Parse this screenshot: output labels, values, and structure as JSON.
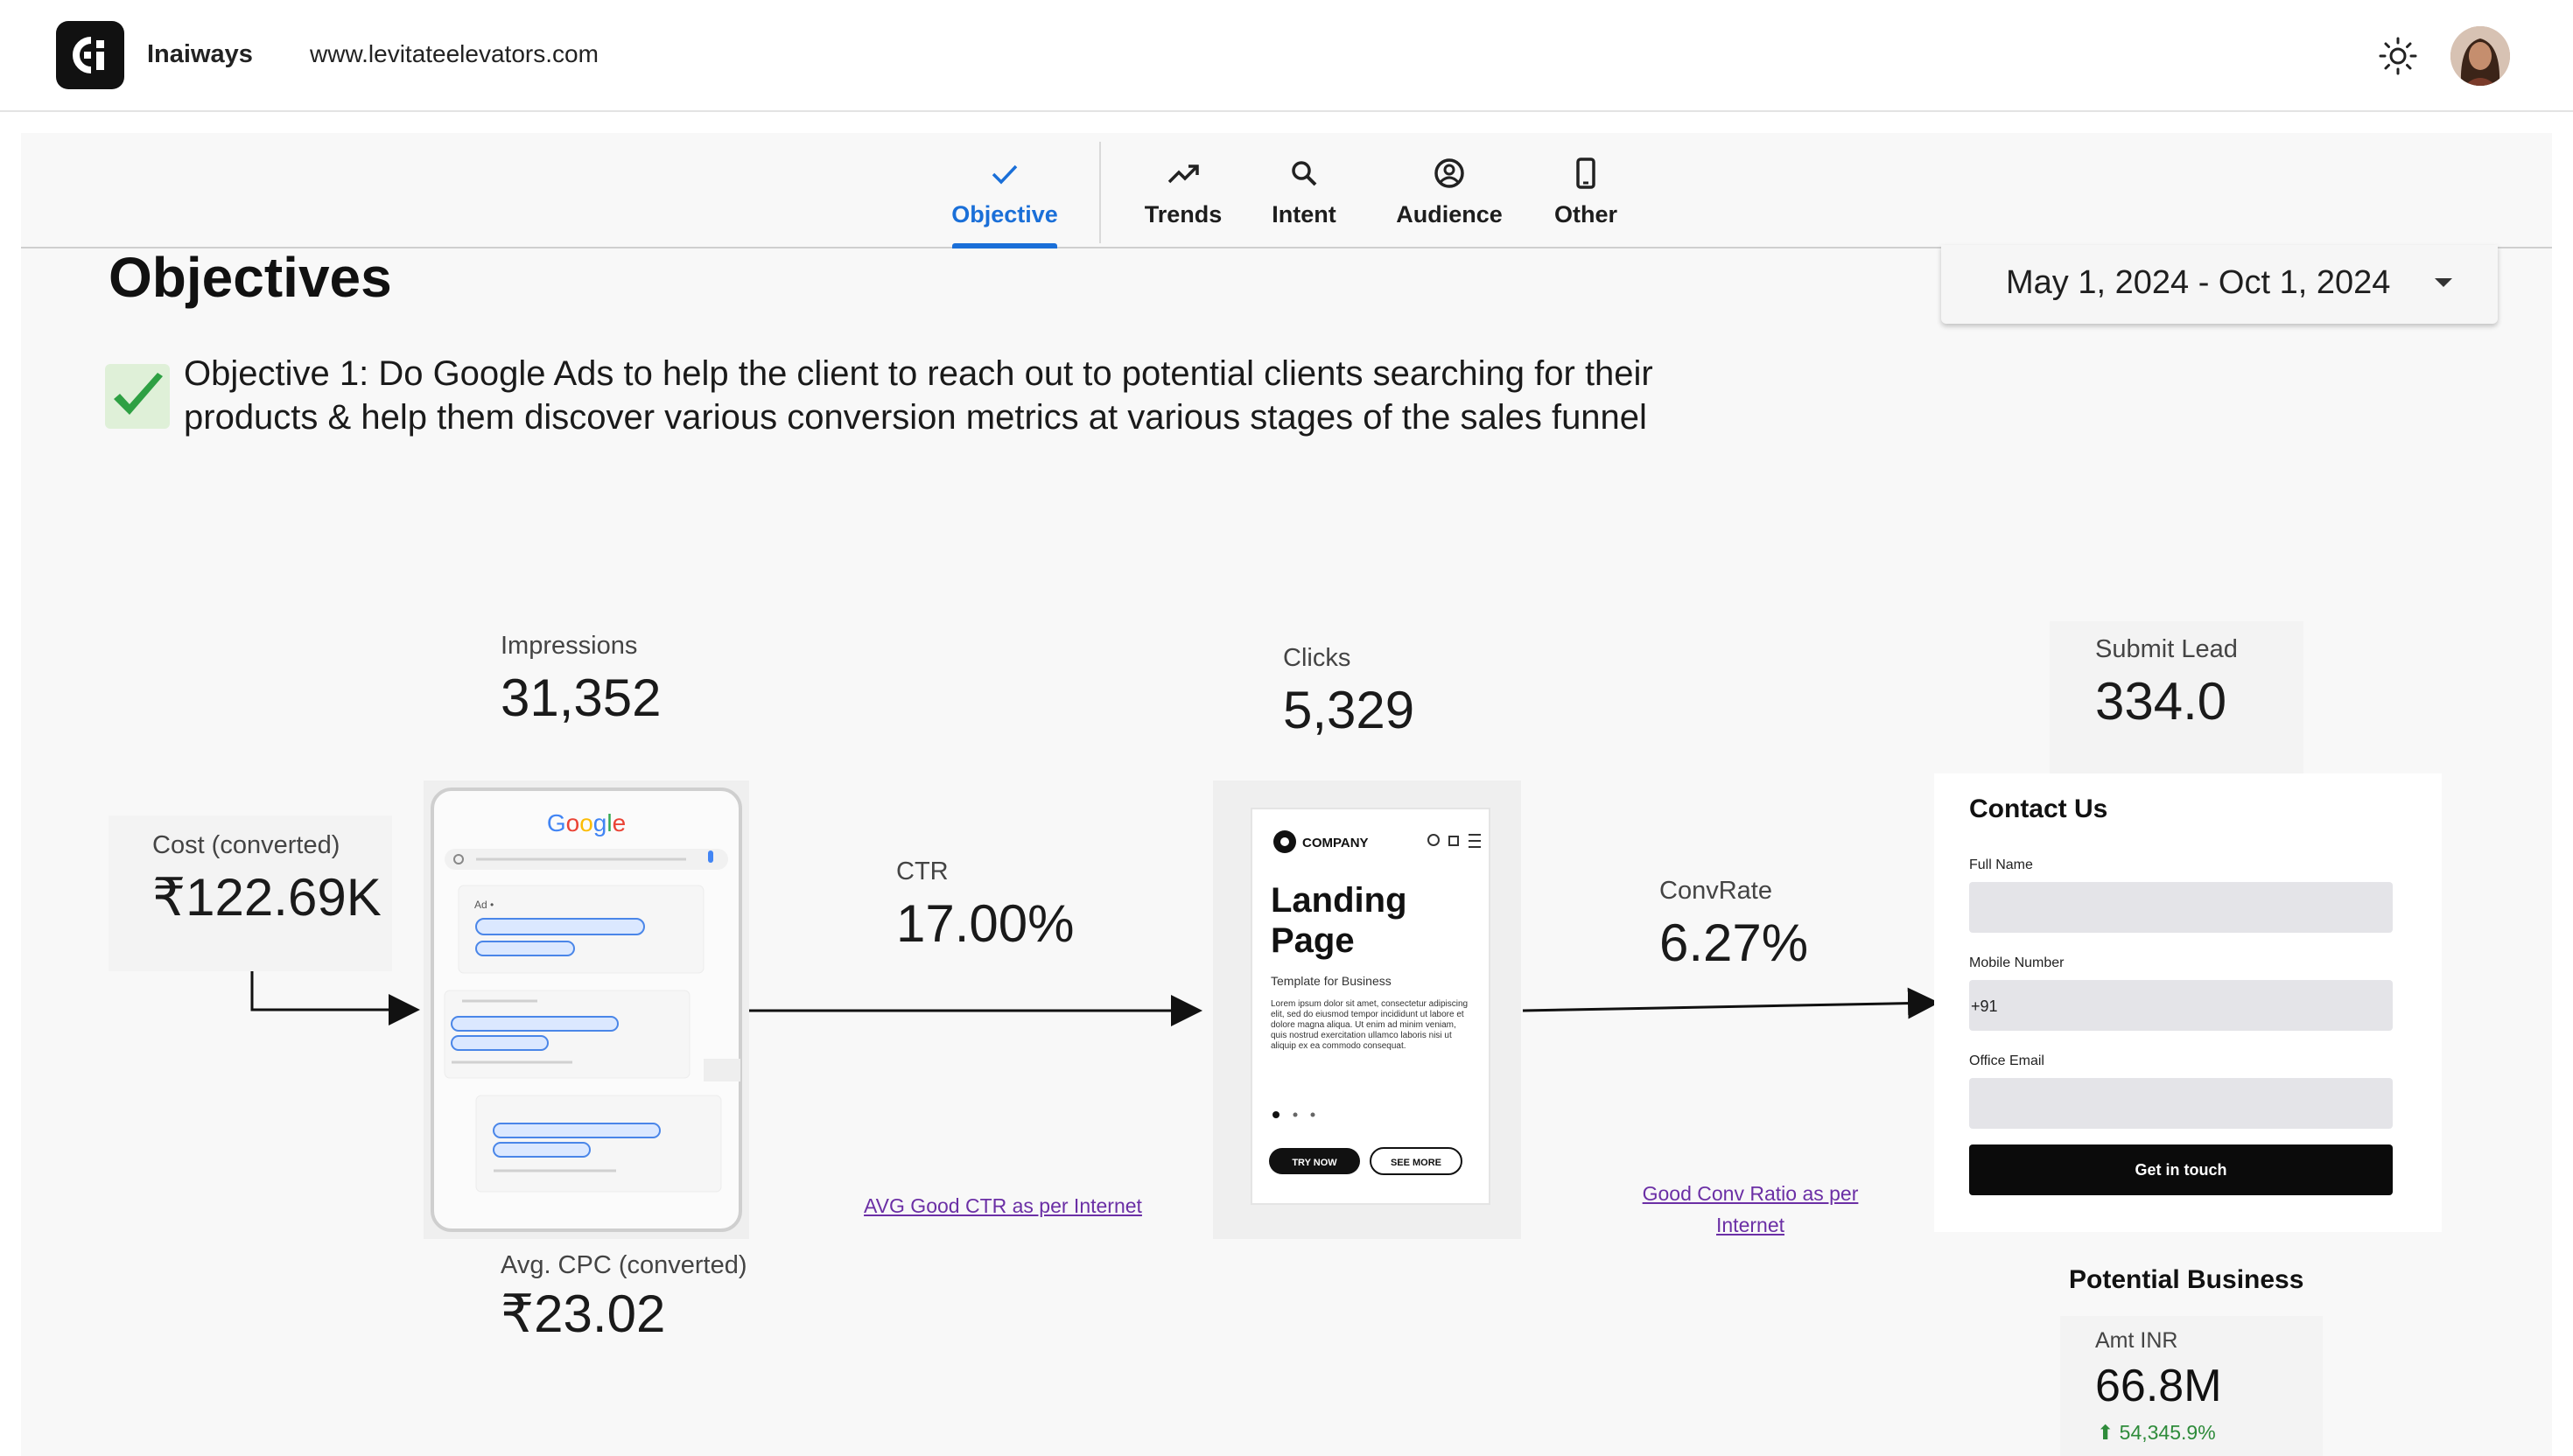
{
  "header": {
    "brand": "Inaiways",
    "site_url": "www.levitateelevators.com",
    "theme_icon": "sun-icon",
    "avatar_icon": "user-avatar"
  },
  "tabs": [
    {
      "label": "Objective",
      "icon": "check-icon",
      "active": true
    },
    {
      "label": "Trends",
      "icon": "trending-up-icon",
      "active": false
    },
    {
      "label": "Intent",
      "icon": "search-icon",
      "active": false
    },
    {
      "label": "Audience",
      "icon": "person-circle-icon",
      "active": false
    },
    {
      "label": "Other",
      "icon": "phone-icon",
      "active": false
    }
  ],
  "page": {
    "title": "Objectives",
    "date_range": "May 1, 2024 - Oct 1, 2024",
    "objective_text": "Objective 1: Do Google Ads to help the client to reach out to potential clients searching for their products & help them discover various conversion metrics at various stages of the sales funnel"
  },
  "funnel": {
    "impressions": {
      "label": "Impressions",
      "value": "31,352"
    },
    "cost": {
      "label": "Cost (converted)",
      "value": "₹122.69K"
    },
    "avg_cpc": {
      "label": "Avg. CPC (converted)",
      "value": "₹23.02"
    },
    "ctr": {
      "label": "CTR",
      "value": "17.00%",
      "link": "AVG Good CTR as per Internet"
    },
    "clicks": {
      "label": "Clicks",
      "value": "5,329"
    },
    "conv_rate": {
      "label": "ConvRate",
      "value": "6.27%",
      "link_line1": "Good Conv Ratio as per",
      "link_line2": "Internet"
    },
    "submit_lead": {
      "label": "Submit Lead",
      "value": "334.0"
    }
  },
  "google_illustration": {
    "logo": "Google",
    "ad_tag": "Ad •"
  },
  "landing_illustration": {
    "company": "COMPANY",
    "title_line1": "Landing",
    "title_line2": "Page",
    "subtitle": "Template for Business",
    "body": "Lorem ipsum dolor sit amet, consectetur adipiscing elit, sed do eiusmod tempor incididunt ut labore et dolore magna aliqua. Ut enim ad minim veniam, quis nostrud exercitation ullamco laboris nisi ut aliquip ex ea commodo consequat.",
    "btn_primary": "TRY NOW",
    "btn_secondary": "SEE MORE"
  },
  "contact_form": {
    "title": "Contact Us",
    "full_name_label": "Full Name",
    "mobile_label": "Mobile Number",
    "mobile_value": "+91",
    "email_label": "Office Email",
    "cta": "Get in touch"
  },
  "potential_business": {
    "title": "Potential Business",
    "label": "Amt INR",
    "value": "66.8M",
    "change": "54,345.9%",
    "change_color": "#2e8b3a"
  },
  "colors": {
    "accent": "#1a6fd8",
    "link": "#6b2fa5"
  }
}
